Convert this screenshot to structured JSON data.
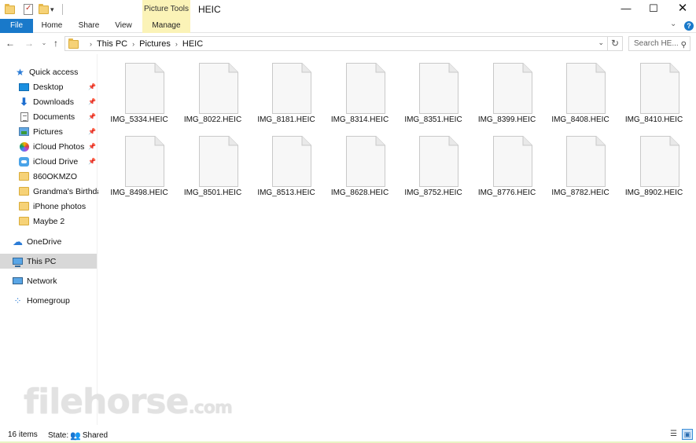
{
  "window": {
    "title": "HEIC",
    "contextual_tab_group": "Picture Tools",
    "controls": {
      "minimize": "—",
      "maximize": "☐",
      "close": "✕"
    }
  },
  "ribbon": {
    "tabs": [
      {
        "label": "File"
      },
      {
        "label": "Home"
      },
      {
        "label": "Share"
      },
      {
        "label": "View"
      },
      {
        "label": "Manage"
      }
    ]
  },
  "address_bar": {
    "breadcrumbs": [
      "This PC",
      "Pictures",
      "HEIC"
    ],
    "search_placeholder": "Search HE..."
  },
  "sidebar": {
    "items": [
      {
        "label": "Quick access",
        "icon": "star-icon"
      },
      {
        "label": "Desktop",
        "icon": "desktop-icon",
        "pinned": true
      },
      {
        "label": "Downloads",
        "icon": "downloads-icon",
        "pinned": true
      },
      {
        "label": "Documents",
        "icon": "documents-icon",
        "pinned": true
      },
      {
        "label": "Pictures",
        "icon": "pictures-icon",
        "pinned": true
      },
      {
        "label": "iCloud Photos",
        "icon": "icloud-photos-icon",
        "pinned": true
      },
      {
        "label": "iCloud Drive",
        "icon": "icloud-drive-icon",
        "pinned": true
      },
      {
        "label": "860OKMZO",
        "icon": "folder-icon"
      },
      {
        "label": "Grandma's Birthday",
        "icon": "folder-icon"
      },
      {
        "label": "iPhone photos",
        "icon": "folder-icon"
      },
      {
        "label": "Maybe 2",
        "icon": "folder-icon"
      },
      {
        "label": "OneDrive",
        "icon": "onedrive-icon"
      },
      {
        "label": "This PC",
        "icon": "this-pc-icon",
        "selected": true
      },
      {
        "label": "Network",
        "icon": "network-icon"
      },
      {
        "label": "Homegroup",
        "icon": "homegroup-icon"
      }
    ]
  },
  "files": [
    {
      "name": "IMG_5334.HEIC"
    },
    {
      "name": "IMG_8022.HEIC"
    },
    {
      "name": "IMG_8181.HEIC"
    },
    {
      "name": "IMG_8314.HEIC"
    },
    {
      "name": "IMG_8351.HEIC"
    },
    {
      "name": "IMG_8399.HEIC"
    },
    {
      "name": "IMG_8408.HEIC"
    },
    {
      "name": "IMG_8410.HEIC"
    },
    {
      "name": "IMG_8498.HEIC"
    },
    {
      "name": "IMG_8501.HEIC"
    },
    {
      "name": "IMG_8513.HEIC"
    },
    {
      "name": "IMG_8628.HEIC"
    },
    {
      "name": "IMG_8752.HEIC"
    },
    {
      "name": "IMG_8776.HEIC"
    },
    {
      "name": "IMG_8782.HEIC"
    },
    {
      "name": "IMG_8902.HEIC"
    }
  ],
  "status": {
    "item_count": "16 items",
    "state_label": "State:",
    "state_value": "Shared"
  },
  "watermark": {
    "text": "filehorse",
    "suffix": ".com"
  },
  "colors": {
    "accent": "#1979ca",
    "contextual_tab": "#fbf3b7",
    "selection": "#d8d8d8",
    "folder": "#f6d277"
  }
}
